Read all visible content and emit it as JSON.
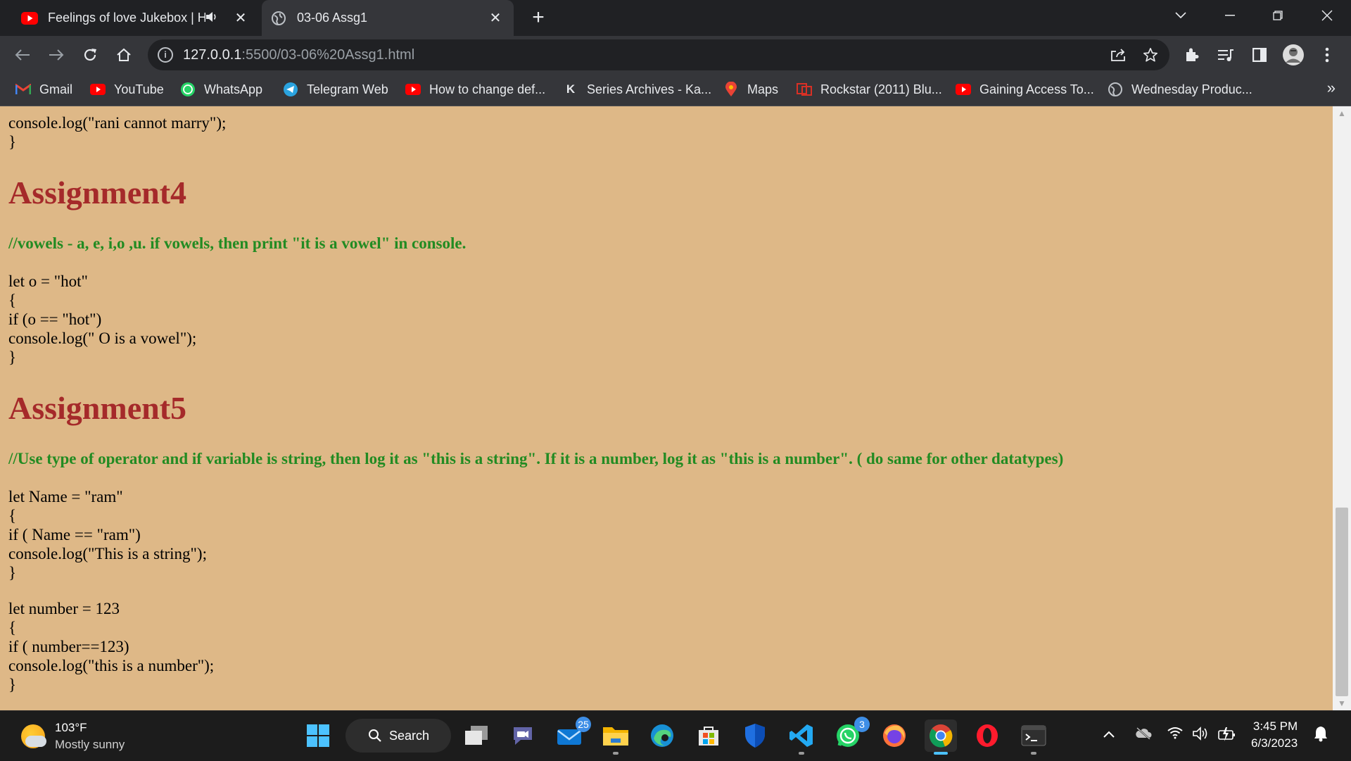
{
  "browser": {
    "tabs": [
      {
        "title": "Feelings of love Jukebox | HT",
        "favicon": "youtube-icon",
        "audio": true
      },
      {
        "title": "03-06 Assg1",
        "favicon": "globe-icon",
        "active": true
      }
    ],
    "address": {
      "host": "127.0.0.1",
      "path": ":5500/03-06%20Assg1.html"
    },
    "bookmarks": [
      {
        "label": "Gmail",
        "icon": "gmail-icon"
      },
      {
        "label": "YouTube",
        "icon": "youtube-icon"
      },
      {
        "label": "WhatsApp",
        "icon": "whatsapp-icon"
      },
      {
        "label": "Telegram Web",
        "icon": "telegram-icon"
      },
      {
        "label": "How to change def...",
        "icon": "youtube-icon"
      },
      {
        "label": "Series Archives - Ka...",
        "icon": "k-site-icon"
      },
      {
        "label": "Maps",
        "icon": "maps-icon"
      },
      {
        "label": "Rockstar (2011) Blu...",
        "icon": "film-site-icon"
      },
      {
        "label": "Gaining Access To...",
        "icon": "youtube-icon"
      },
      {
        "label": "Wednesday Produc...",
        "icon": "globe-icon"
      }
    ]
  },
  "page": {
    "top_code": [
      "console.log(\"rani cannot marry\");",
      "}"
    ],
    "assignment4": {
      "heading": "Assignment4",
      "comment": "//vowels - a, e, i,o ,u. if vowels, then print \"it is a vowel\" in console.",
      "code": [
        "let o = \"hot\"",
        "{",
        "if (o == \"hot\")",
        "console.log(\" O is a vowel\");",
        "}"
      ]
    },
    "assignment5": {
      "heading": "Assignment5",
      "comment": "//Use type of operator and if variable is string, then log it as \"this is a string\". If it is a number, log it as \"this is a number\". ( do same for other datatypes)",
      "code1": [
        "let Name = \"ram\"",
        "{",
        "if ( Name == \"ram\")",
        "console.log(\"This is a string\");",
        "}"
      ],
      "code2": [
        "let number = 123",
        "{",
        "if ( number==123)",
        "console.log(\"this is a number\");",
        "}"
      ]
    },
    "colors": {
      "background": "#deb887",
      "heading": "#a52a2a",
      "comment": "#228b22"
    }
  },
  "taskbar": {
    "weather": {
      "temp": "103°F",
      "condition": "Mostly sunny"
    },
    "search_label": "Search",
    "mail_badge": "25",
    "whatsapp_badge": "3",
    "clock": {
      "time": "3:45 PM",
      "date": "6/3/2023"
    }
  }
}
